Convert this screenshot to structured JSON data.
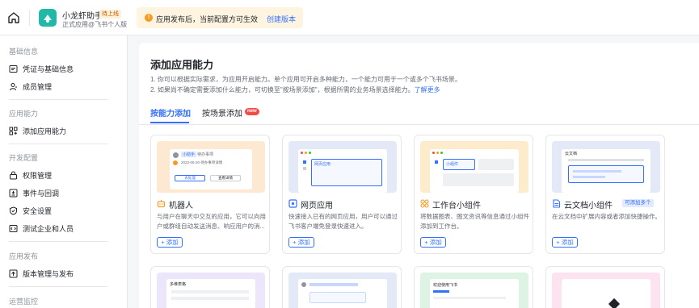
{
  "header": {
    "app_name": "小龙虾助手",
    "app_status": "待上线",
    "app_subtitle": "正式应用@飞书个人版",
    "notice_text": "应用发布后，当前配置方可生效",
    "notice_link": "创建版本"
  },
  "sidebar": {
    "sections": [
      {
        "title": "基础信息",
        "items": [
          "凭证与基础信息",
          "成员管理"
        ]
      },
      {
        "title": "应用能力",
        "items": [
          "添加应用能力"
        ]
      },
      {
        "title": "开发配置",
        "items": [
          "权限管理",
          "事件与回调",
          "安全设置",
          "测试企业和人员"
        ]
      },
      {
        "title": "应用发布",
        "items": [
          "版本管理与发布"
        ]
      },
      {
        "title": "运营监控",
        "items": []
      }
    ]
  },
  "main": {
    "title": "添加应用能力",
    "desc_line1": "1. 你可以根据实际需求，为应用开启能力。单个应用可开启多种能力，一个能力可用于一个或多个飞书场景。",
    "desc_line2": "2. 如果尚不确定需要添加什么能力，可切换至\"按场景添加\"，根据所需的业务场景选择能力。",
    "desc_link": "了解更多",
    "tabs": [
      "按能力添加",
      "按场景添加"
    ],
    "new_badge": "new",
    "cards": [
      {
        "name": "机器人",
        "desc": "与用户在聊天中交互的应用，它可以向用户或群组自动发送消息、响应用户的消...",
        "add": "+ 添加",
        "badge": ""
      },
      {
        "name": "网页应用",
        "desc": "快速接入已有的网页应用，用户可以通过飞书客户端免登录快速进入。",
        "add": "+ 添加",
        "badge": ""
      },
      {
        "name": "工作台小组件",
        "desc": "将数据图表、图文资讯等信息通过小组件添加到工作台。",
        "add": "+ 添加",
        "badge": ""
      },
      {
        "name": "云文档小组件",
        "desc": "在云文档中扩展内容或者添加快捷操作。",
        "add": "+ 添加",
        "badge": "可添加多个"
      }
    ],
    "thumb_texts": {
      "bot_tag1": "小助手",
      "bot_tag2": "待办事项",
      "bot_line": "2022-05-20 待办事项详情",
      "bot_btn1": "去处理",
      "bot_btn2": "查看详情",
      "web_tag": "网页应用",
      "widget_tag": "小组件",
      "doc_title": "云文档",
      "bottom1": "多维表格",
      "bottom3": "欢迎使用飞书"
    }
  },
  "colors": {
    "accent": "#3370ff",
    "brand": "#21b8a7",
    "warning": "#f59a23",
    "new": "#f54a45"
  }
}
